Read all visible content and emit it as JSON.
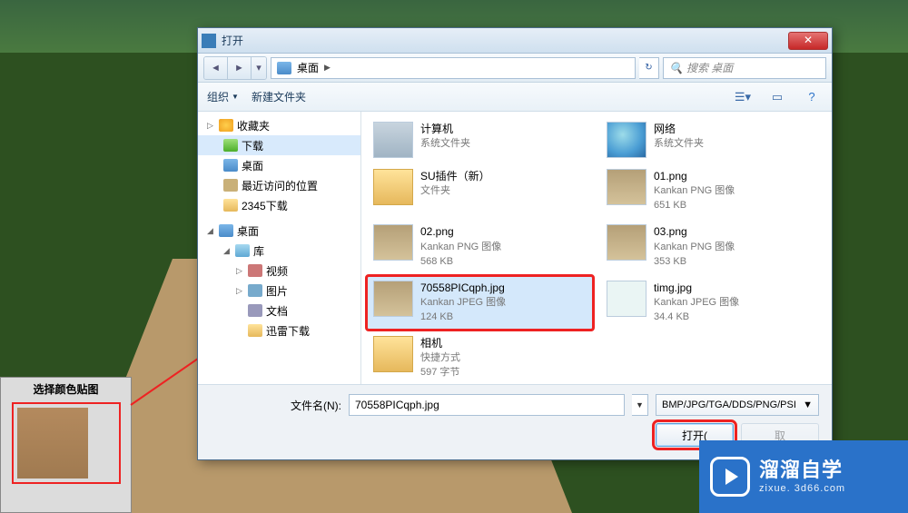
{
  "scene": {
    "mat_title": "选择颜色贴图"
  },
  "dialog": {
    "title": "打开",
    "close": "✕",
    "nav": {
      "location_label": "桌面",
      "refresh": "↻",
      "search_placeholder": "搜索 桌面"
    },
    "toolbar": {
      "organize": "组织",
      "newfolder": "新建文件夹"
    },
    "tree": {
      "fav": "收藏夹",
      "downloads": "下载",
      "desktop": "桌面",
      "recent": "最近访问的位置",
      "d2345": "2345下载",
      "desk2": "桌面",
      "library": "库",
      "video": "视频",
      "pictures": "图片",
      "docs": "文档",
      "xunlei": "迅雷下载"
    },
    "files": [
      {
        "id": "computer",
        "name": "计算机",
        "meta1": "系统文件夹",
        "meta2": "",
        "thumb": "monitor"
      },
      {
        "id": "network",
        "name": "网络",
        "meta1": "系统文件夹",
        "meta2": "",
        "thumb": "globe"
      },
      {
        "id": "suplugin",
        "name": "SU插件（新）",
        "meta1": "文件夹",
        "meta2": "",
        "thumb": "fold"
      },
      {
        "id": "01png",
        "name": "01.png",
        "meta1": "Kankan PNG 图像",
        "meta2": "651 KB",
        "thumb": "img"
      },
      {
        "id": "02png",
        "name": "02.png",
        "meta1": "Kankan PNG 图像",
        "meta2": "568 KB",
        "thumb": "img"
      },
      {
        "id": "03png",
        "name": "03.png",
        "meta1": "Kankan PNG 图像",
        "meta2": "353 KB",
        "thumb": "img"
      },
      {
        "id": "70558",
        "name": "70558PICqph.jpg",
        "meta1": "Kankan JPEG 图像",
        "meta2": "124 KB",
        "thumb": "img"
      },
      {
        "id": "timg",
        "name": "timg.jpg",
        "meta1": "Kankan JPEG 图像",
        "meta2": "34.4 KB",
        "thumb": "img"
      },
      {
        "id": "camera",
        "name": "相机",
        "meta1": "快捷方式",
        "meta2": "597 字节",
        "thumb": "fold"
      }
    ],
    "filename_label": "文件名(N):",
    "filename_value": "70558PICqph.jpg",
    "filter": "BMP/JPG/TGA/DDS/PNG/PSI",
    "open_btn": "打开(",
    "cancel_btn": "取"
  },
  "watermark": {
    "big": "溜溜自学",
    "small": "zixue. 3d66.com"
  }
}
